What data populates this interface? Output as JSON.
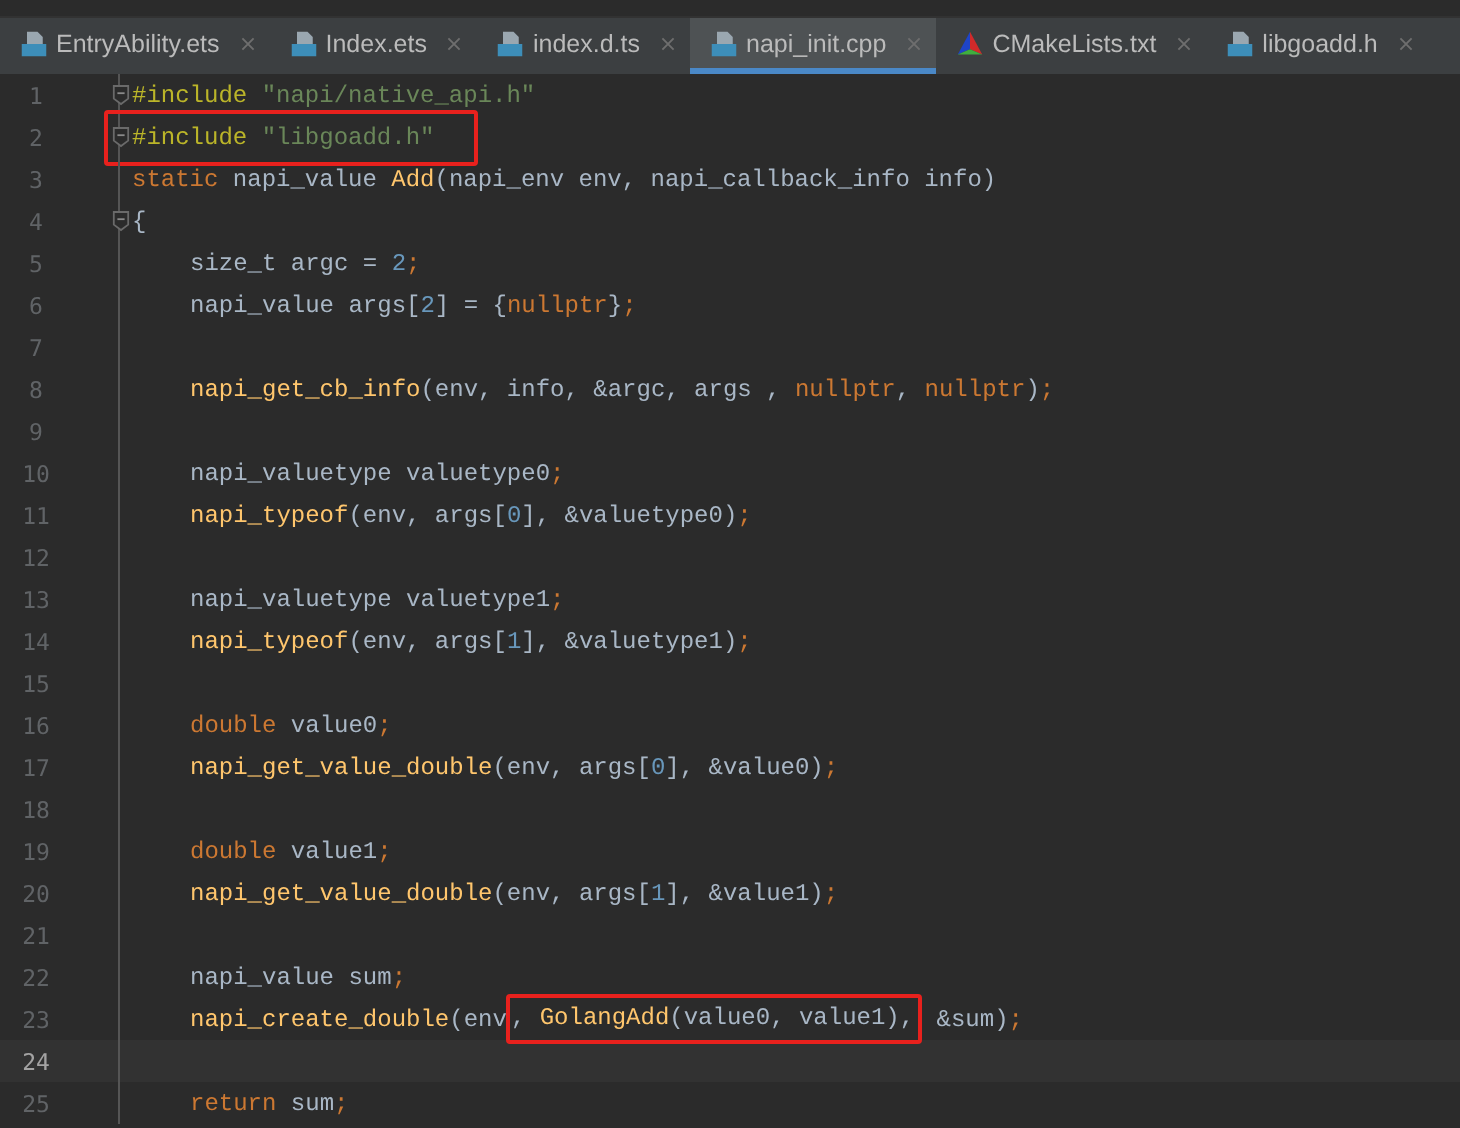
{
  "tabs": [
    {
      "label": "EntryAbility.ets",
      "kind": "ets",
      "selected": false
    },
    {
      "label": "Index.ets",
      "kind": "ets",
      "selected": false
    },
    {
      "label": "index.d.ts",
      "kind": "ts",
      "selected": false
    },
    {
      "label": "napi_init.cpp",
      "kind": "cpp",
      "selected": true
    },
    {
      "label": "CMakeLists.txt",
      "kind": "cmake",
      "selected": false
    },
    {
      "label": "libgoadd.h",
      "kind": "h",
      "selected": false
    }
  ],
  "lines": [
    {
      "number": "1",
      "fold": true,
      "boxed": false,
      "current": false,
      "tokens": [
        {
          "kind": "macro",
          "text": "#include "
        },
        {
          "kind": "string",
          "text": "\"napi/native_api.h\""
        }
      ]
    },
    {
      "number": "2",
      "fold": true,
      "boxed": true,
      "current": false,
      "tokens": [
        {
          "kind": "macro",
          "text": "#include "
        },
        {
          "kind": "string",
          "text": "\"libgoadd.h\""
        }
      ]
    },
    {
      "number": "3",
      "fold": false,
      "boxed": false,
      "current": false,
      "tokens": [
        {
          "kind": "keyword",
          "text": "static "
        },
        {
          "kind": "plain",
          "text": "napi_value "
        },
        {
          "kind": "func",
          "text": "Add"
        },
        {
          "kind": "plain",
          "text": "(napi_env env, napi_callback_info info)"
        }
      ]
    },
    {
      "number": "4",
      "fold": true,
      "boxed": false,
      "current": false,
      "tokens": [
        {
          "kind": "plain",
          "text": "{"
        }
      ],
      "children": [
        {
          "number": "5",
          "fold": false,
          "boxed": false,
          "current": false,
          "tokens": [
            {
              "kind": "plain",
              "text": "size_t argc = "
            },
            {
              "kind": "number",
              "text": "2"
            },
            {
              "kind": "keyword",
              "text": ";"
            }
          ]
        },
        {
          "number": "6",
          "fold": false,
          "boxed": false,
          "current": false,
          "tokens": [
            {
              "kind": "plain",
              "text": "napi_value args["
            },
            {
              "kind": "number",
              "text": "2"
            },
            {
              "kind": "plain",
              "text": "] = {"
            },
            {
              "kind": "keyword",
              "text": "nullptr"
            },
            {
              "kind": "plain",
              "text": "}"
            },
            {
              "kind": "keyword",
              "text": ";"
            }
          ]
        },
        {
          "number": "7",
          "fold": false,
          "boxed": false,
          "current": false
        },
        {
          "number": "8",
          "fold": false,
          "boxed": false,
          "current": false,
          "tokens": [
            {
              "kind": "func",
              "text": "napi_get_cb_info"
            },
            {
              "kind": "plain",
              "text": "(env, info, &argc, args , "
            },
            {
              "kind": "keyword",
              "text": "nullptr"
            },
            {
              "kind": "plain",
              "text": ", "
            },
            {
              "kind": "keyword",
              "text": "nullptr"
            },
            {
              "kind": "plain",
              "text": ")"
            },
            {
              "kind": "keyword",
              "text": ";"
            }
          ]
        },
        {
          "number": "9",
          "fold": false,
          "boxed": false,
          "current": false
        },
        {
          "number": "10",
          "fold": false,
          "boxed": false,
          "current": false,
          "tokens": [
            {
              "kind": "plain",
              "text": "napi_valuetype valuetype0"
            },
            {
              "kind": "keyword",
              "text": ";"
            }
          ]
        },
        {
          "number": "11",
          "fold": false,
          "boxed": false,
          "current": false,
          "tokens": [
            {
              "kind": "func",
              "text": "napi_typeof"
            },
            {
              "kind": "plain",
              "text": "(env, args["
            },
            {
              "kind": "number",
              "text": "0"
            },
            {
              "kind": "plain",
              "text": "], &valuetype0)"
            },
            {
              "kind": "keyword",
              "text": ";"
            }
          ]
        },
        {
          "number": "12",
          "fold": false,
          "boxed": false,
          "current": false
        },
        {
          "number": "13",
          "fold": false,
          "boxed": false,
          "current": false,
          "tokens": [
            {
              "kind": "plain",
              "text": "napi_valuetype valuetype1"
            },
            {
              "kind": "keyword",
              "text": ";"
            }
          ]
        },
        {
          "number": "14",
          "fold": false,
          "boxed": false,
          "current": false,
          "tokens": [
            {
              "kind": "func",
              "text": "napi_typeof"
            },
            {
              "kind": "plain",
              "text": "(env, args["
            },
            {
              "kind": "number",
              "text": "1"
            },
            {
              "kind": "plain",
              "text": "], &valuetype1)"
            },
            {
              "kind": "keyword",
              "text": ";"
            }
          ]
        },
        {
          "number": "15",
          "fold": false,
          "boxed": false,
          "current": false
        },
        {
          "number": "16",
          "fold": false,
          "boxed": false,
          "current": false,
          "tokens": [
            {
              "kind": "keyword",
              "text": "double "
            },
            {
              "kind": "plain",
              "text": "value0"
            },
            {
              "kind": "keyword",
              "text": ";"
            }
          ]
        },
        {
          "number": "17",
          "fold": false,
          "boxed": false,
          "current": false,
          "tokens": [
            {
              "kind": "func",
              "text": "napi_get_value_double"
            },
            {
              "kind": "plain",
              "text": "(env, args["
            },
            {
              "kind": "number",
              "text": "0"
            },
            {
              "kind": "plain",
              "text": "], &value0)"
            },
            {
              "kind": "keyword",
              "text": ";"
            }
          ]
        },
        {
          "number": "18",
          "fold": false,
          "boxed": false,
          "current": false
        },
        {
          "number": "19",
          "fold": false,
          "boxed": false,
          "current": false,
          "tokens": [
            {
              "kind": "keyword",
              "text": "double "
            },
            {
              "kind": "plain",
              "text": "value1"
            },
            {
              "kind": "keyword",
              "text": ";"
            }
          ]
        },
        {
          "number": "20",
          "fold": false,
          "boxed": false,
          "current": false,
          "tokens": [
            {
              "kind": "func",
              "text": "napi_get_value_double"
            },
            {
              "kind": "plain",
              "text": "(env, args["
            },
            {
              "kind": "number",
              "text": "1"
            },
            {
              "kind": "plain",
              "text": "], &value1)"
            },
            {
              "kind": "keyword",
              "text": ";"
            }
          ]
        },
        {
          "number": "21",
          "fold": false,
          "boxed": false,
          "current": false
        },
        {
          "number": "22",
          "fold": false,
          "boxed": false,
          "current": false,
          "tokens": [
            {
              "kind": "plain",
              "text": "napi_value sum"
            },
            {
              "kind": "keyword",
              "text": ";"
            }
          ]
        },
        {
          "number": "23",
          "fold": false,
          "boxed": false,
          "current": false,
          "tokens": [
            {
              "kind": "func",
              "text": "napi_create_double"
            },
            {
              "kind": "plain",
              "text": "(env"
            },
            {
              "kind": "box",
              "tokens": [
                {
                  "kind": "plain",
                  "text": ", "
                },
                {
                  "kind": "func",
                  "text": "GolangAdd"
                },
                {
                  "kind": "plain",
                  "text": "(value0, value1),"
                }
              ]
            },
            {
              "kind": "plain",
              "text": " &sum)"
            },
            {
              "kind": "keyword",
              "text": ";"
            }
          ]
        },
        {
          "number": "24",
          "fold": false,
          "boxed": false,
          "current": true
        },
        {
          "number": "25",
          "fold": false,
          "boxed": false,
          "current": false,
          "tokens": [
            {
              "kind": "keyword",
              "text": "return "
            },
            {
              "kind": "plain",
              "text": "sum"
            },
            {
              "kind": "keyword",
              "text": ";"
            }
          ]
        }
      ]
    }
  ]
}
